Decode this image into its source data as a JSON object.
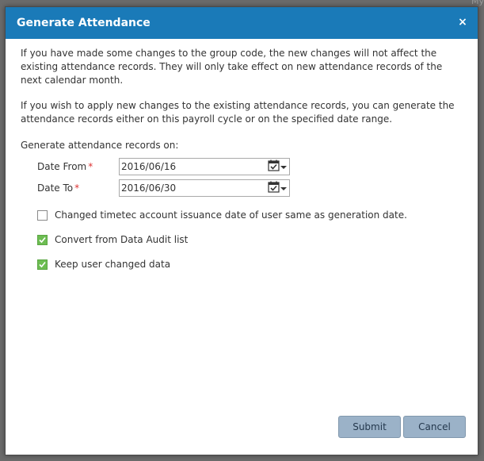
{
  "dialog": {
    "title": "Generate Attendance",
    "close_label": "×",
    "paragraph1": "If you have made some changes to the group code, the new changes will not affect the existing attendance records. They will only take effect on new attendance records of the next calendar month.",
    "paragraph2": "If you wish to apply new changes to the existing attendance records, you can generate the attendance records either on this payroll cycle or on the specified date range.",
    "generate_on_label": "Generate attendance records on:",
    "date_from": {
      "label": "Date From",
      "required_mark": "*",
      "value": "2016/06/16"
    },
    "date_to": {
      "label": "Date To",
      "required_mark": "*",
      "value": "2016/06/30"
    },
    "options": [
      {
        "label": "Changed timetec account issuance date of user same as generation date.",
        "checked": false
      },
      {
        "label": "Convert from Data Audit list",
        "checked": true
      },
      {
        "label": "Keep user changed data",
        "checked": true
      }
    ],
    "submit_label": "Submit",
    "cancel_label": "Cancel"
  },
  "colors": {
    "titlebar": "#1a7ab8",
    "checkbox_checked": "#6dbd52",
    "button_bg": "#9bb2c8",
    "required": "#dd3333",
    "overlay": "#6b6b6b"
  },
  "icons": {
    "calendar": "calendar-icon",
    "dropdown": "chevron-down-icon",
    "check": "checkmark-icon"
  },
  "background_fragments": {
    "top_right": "My"
  }
}
